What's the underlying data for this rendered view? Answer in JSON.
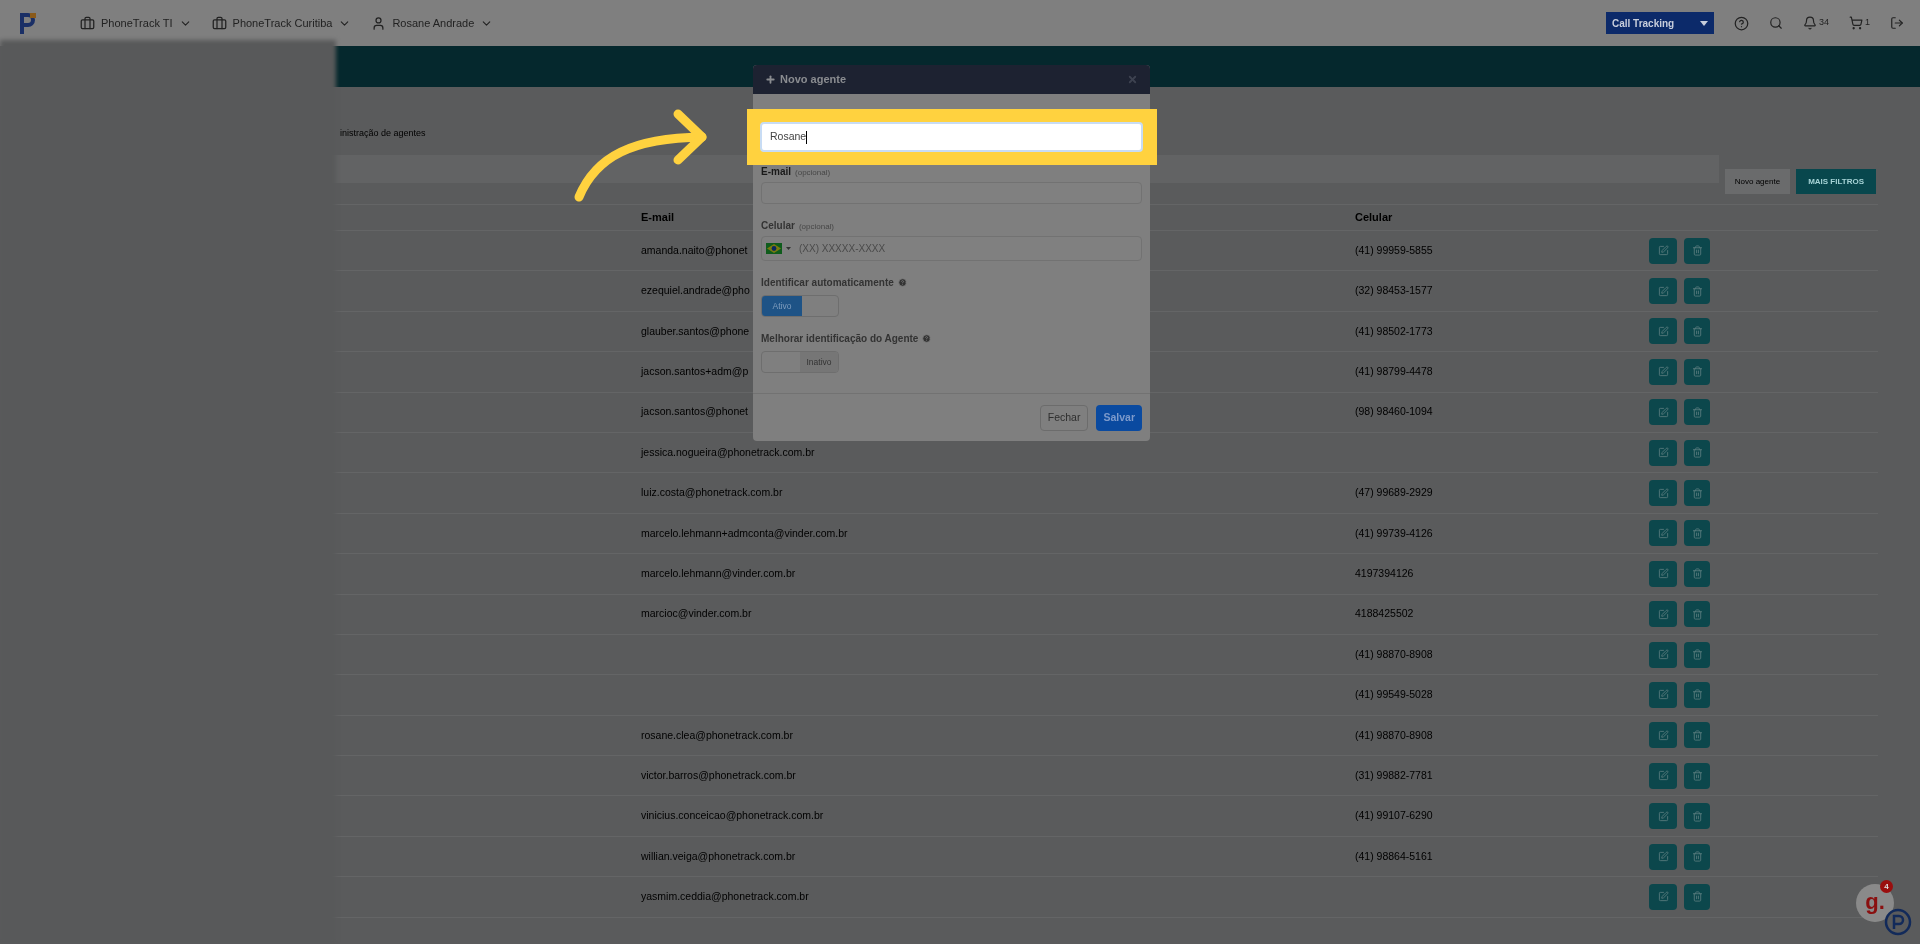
{
  "topbar": {
    "menus": [
      {
        "kind": "company",
        "label": "PhoneTrack TI"
      },
      {
        "kind": "company",
        "label": "PhoneTrack Curitiba"
      },
      {
        "kind": "user",
        "label": "Rosane Andrade"
      }
    ],
    "product_select": "Call Tracking",
    "notifications": "34",
    "cart": "1"
  },
  "breadcrumb": "inistração de agentes",
  "toolbar": {
    "buttons": [
      {
        "kind": "default",
        "label": "Novo agente"
      },
      {
        "kind": "primary",
        "label": "MAIS FILTROS"
      }
    ]
  },
  "table": {
    "columns": [
      "E-mail",
      "Celular"
    ],
    "rows": [
      {
        "email": "amanda.naito@phonet",
        "celular": "(41) 99959-5855"
      },
      {
        "email": "ezequiel.andrade@pho",
        "celular": "(32) 98453-1577"
      },
      {
        "email": "glauber.santos@phone",
        "celular": "(41) 98502-1773"
      },
      {
        "email": "jacson.santos+adm@p",
        "celular": "(41) 98799-4478"
      },
      {
        "email": "jacson.santos@phonet",
        "celular": "(98) 98460-1094"
      },
      {
        "email": "jessica.nogueira@phonetrack.com.br"
      },
      {
        "email": "luiz.costa@phonetrack.com.br",
        "celular": "(47) 99689-2929"
      },
      {
        "email": "marcelo.lehmann+admconta@vinder.com.br",
        "celular": "(41) 99739-4126"
      },
      {
        "email": "marcelo.lehmann@vinder.com.br",
        "celular": "4197394126"
      },
      {
        "email": "marcioc@vinder.com.br",
        "celular": "4188425502"
      },
      {
        "celular": "(41) 98870-8908"
      },
      {
        "celular": "(41) 99549-5028"
      },
      {
        "email": "rosane.clea@phonetrack.com.br",
        "celular": "(41) 98870-8908"
      },
      {
        "email": "victor.barros@phonetrack.com.br",
        "celular": "(31) 99882-7781"
      },
      {
        "email": "vinicius.conceicao@phonetrack.com.br",
        "celular": "(41) 99107-6290"
      },
      {
        "email": "willian.veiga@phonetrack.com.br",
        "celular": "(41) 98864-5161"
      },
      {
        "email": "yasmim.ceddia@phonetrack.com.br"
      }
    ]
  },
  "modal": {
    "title": "Novo agente",
    "name_value": "Rosane",
    "email": {
      "label": "E-mail",
      "hint": "(opcional)"
    },
    "phone": {
      "label": "Celular",
      "hint": "(opcional)",
      "placeholder": "(XX) XXXXX-XXXX"
    },
    "toggles": [
      {
        "label": "Identificar automaticamente",
        "on": true,
        "state_text": "Ativo"
      },
      {
        "label": "Melhorar identificação do Agente",
        "on": false,
        "state_text": "Inativo"
      }
    ],
    "buttons": [
      {
        "kind": "default",
        "label": "Fechar"
      },
      {
        "kind": "primary",
        "label": "Salvar"
      }
    ]
  },
  "widget": {
    "text": "g.",
    "badge": "4"
  }
}
